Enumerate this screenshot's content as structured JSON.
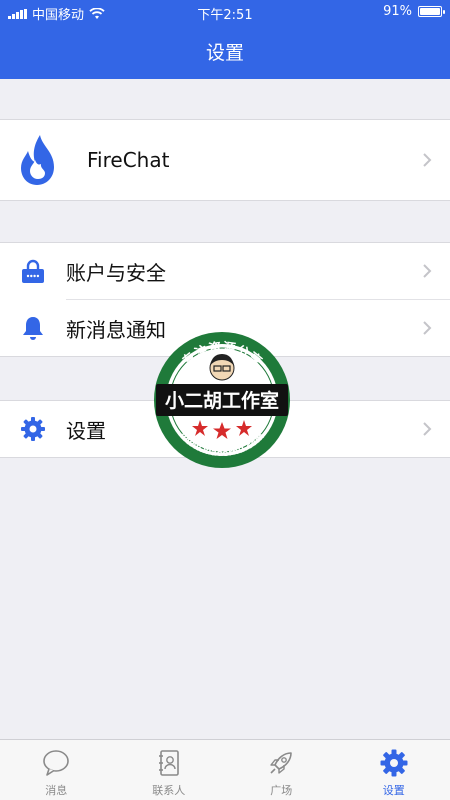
{
  "status_bar": {
    "carrier": "中国移动",
    "time": "下午2:51",
    "battery": "91%",
    "battery_level": 0.91
  },
  "nav": {
    "title": "设置"
  },
  "profile": {
    "name": "FireChat"
  },
  "menu": {
    "account": "账户与安全",
    "notifications": "新消息通知",
    "settings": "设置"
  },
  "tabs": [
    {
      "label": "消息",
      "icon": "message-icon"
    },
    {
      "label": "联系人",
      "icon": "contacts-icon"
    },
    {
      "label": "广场",
      "icon": "rocket-icon"
    },
    {
      "label": "设置",
      "icon": "gear-icon"
    }
  ],
  "watermark": {
    "top_text": "专注资源分享",
    "banner": "小二胡工作室",
    "bottom_text": "www.xiaoerhu.com"
  },
  "colors": {
    "accent": "#3366e6",
    "background": "#efeff4",
    "watermark_green": "#1f7a3a"
  }
}
